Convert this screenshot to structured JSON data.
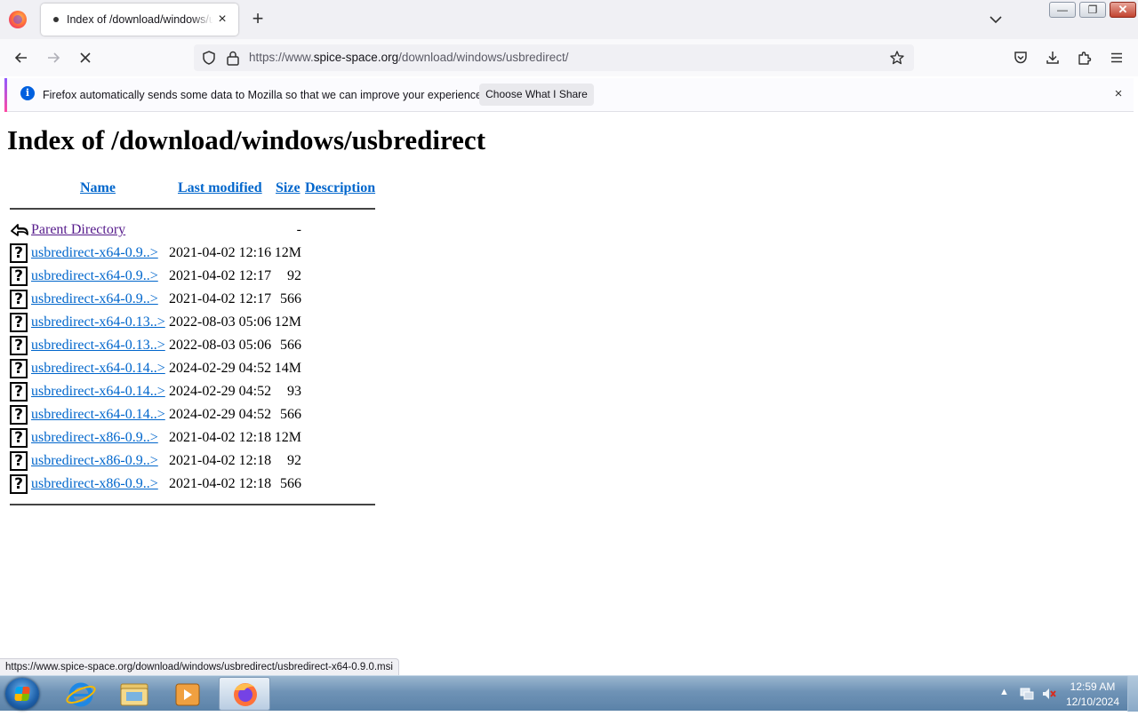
{
  "browser": {
    "tab_title": "Index of /download/windows/usbredirect/",
    "new_tab_label": "+",
    "tab_close_label": "×",
    "url": {
      "scheme": "https://www.",
      "host": "spice-space.org",
      "path": "/download/windows/usbredirect/"
    },
    "window_buttons": {
      "minimize": "—",
      "maximize": "❐",
      "close": "✕"
    }
  },
  "notification": {
    "text": "Firefox automatically sends some data to Mozilla so that we can improve your experience.",
    "button_label": "Choose What I Share",
    "close_label": "×",
    "info_glyph": "i"
  },
  "page": {
    "title": "Index of /download/windows/usbredirect",
    "columns": {
      "name": "Name",
      "last_modified": "Last modified",
      "size": "Size",
      "description": "Description"
    },
    "parent": {
      "name": "Parent Directory",
      "size": "-"
    },
    "rows": [
      {
        "name": "usbredirect-x64-0.9..>",
        "date": "2021-04-02 12:16",
        "size": "12M"
      },
      {
        "name": "usbredirect-x64-0.9..>",
        "date": "2021-04-02 12:17",
        "size": "92"
      },
      {
        "name": "usbredirect-x64-0.9..>",
        "date": "2021-04-02 12:17",
        "size": "566"
      },
      {
        "name": "usbredirect-x64-0.13..>",
        "date": "2022-08-03 05:06",
        "size": "12M"
      },
      {
        "name": "usbredirect-x64-0.13..>",
        "date": "2022-08-03 05:06",
        "size": "566"
      },
      {
        "name": "usbredirect-x64-0.14..>",
        "date": "2024-02-29 04:52",
        "size": "14M"
      },
      {
        "name": "usbredirect-x64-0.14..>",
        "date": "2024-02-29 04:52",
        "size": "93"
      },
      {
        "name": "usbredirect-x64-0.14..>",
        "date": "2024-02-29 04:52",
        "size": "566"
      },
      {
        "name": "usbredirect-x86-0.9..>",
        "date": "2021-04-02 12:18",
        "size": "12M"
      },
      {
        "name": "usbredirect-x86-0.9..>",
        "date": "2021-04-02 12:18",
        "size": "92"
      },
      {
        "name": "usbredirect-x86-0.9..>",
        "date": "2021-04-02 12:18",
        "size": "566"
      }
    ],
    "unknown_file_glyph": "?"
  },
  "status_bar": {
    "link_url": "https://www.spice-space.org/download/windows/usbredirect/usbredirect-x64-0.9.0.msi"
  },
  "taskbar": {
    "tray_arrow": "▲",
    "clock_time": "12:59 AM",
    "clock_date": "12/10/2024"
  },
  "colors": {
    "link": "#0066cc",
    "visited_link": "#551a8b",
    "accent_info": "#0060df"
  }
}
